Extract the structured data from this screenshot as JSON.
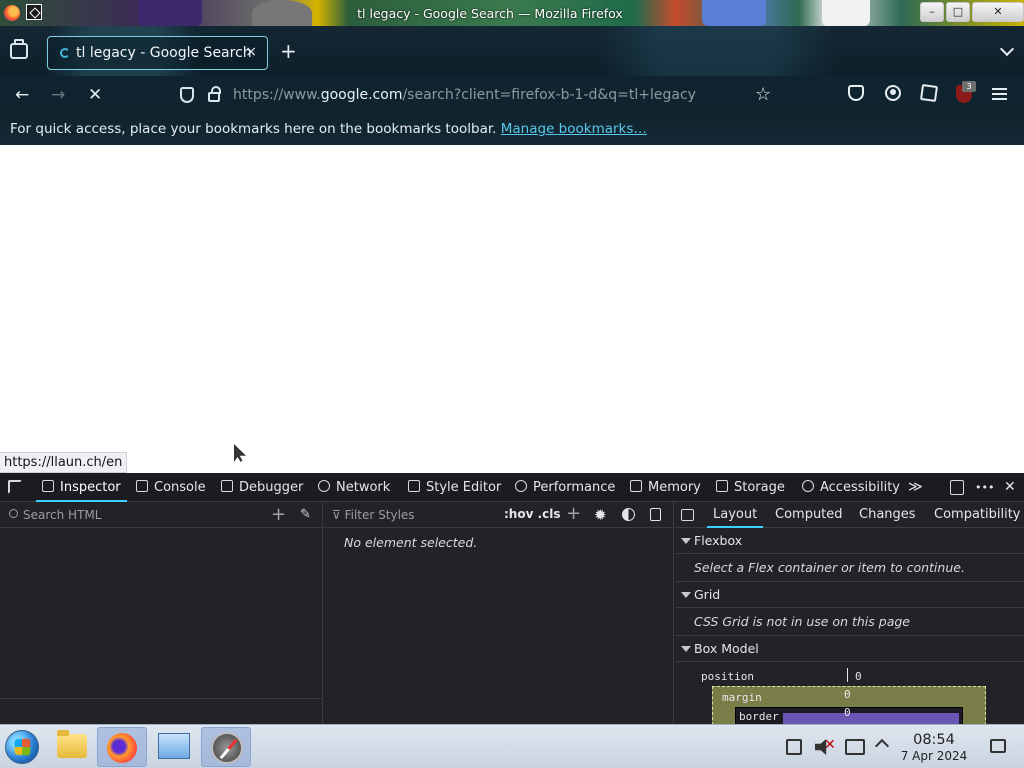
{
  "window": {
    "title": "tl legacy - Google Search — Mozilla Firefox",
    "minimize_glyph": "–",
    "maximize_glyph": "□",
    "close_glyph": "✕"
  },
  "tabs": [
    {
      "label": "tl legacy - Google Search",
      "close_glyph": "×"
    }
  ],
  "new_tab_glyph": "+",
  "navbar": {
    "back_glyph": "←",
    "forward_glyph": "→",
    "stop_glyph": "✕",
    "url_prefix": "https://www.",
    "url_host": "google.com",
    "url_path": "/search?client=firefox-b-1-d&q=tl+legacy",
    "star_glyph": "☆",
    "extension_badge": "3"
  },
  "bookmarks_toolbar": {
    "message": "For quick access, place your bookmarks here on the bookmarks toolbar.",
    "manage_link": "Manage bookmarks…"
  },
  "status_link": "https://llaun.ch/en",
  "devtools": {
    "tabs": [
      {
        "label": "Inspector",
        "icon": "inspector-icon",
        "active": true
      },
      {
        "label": "Console",
        "icon": "console-icon"
      },
      {
        "label": "Debugger",
        "icon": "debugger-icon"
      },
      {
        "label": "Network",
        "icon": "network-icon"
      },
      {
        "label": "Style Editor",
        "icon": "style-editor-icon"
      },
      {
        "label": "Performance",
        "icon": "performance-icon"
      },
      {
        "label": "Memory",
        "icon": "memory-icon"
      },
      {
        "label": "Storage",
        "icon": "storage-icon"
      },
      {
        "label": "Accessibility",
        "icon": "accessibility-icon"
      }
    ],
    "overflow_glyph": "≫",
    "more_glyph": "•••",
    "close_glyph": "✕",
    "search_html_placeholder": "Search HTML",
    "filter_styles_placeholder": "Filter Styles",
    "pseudo_toggle": ":hov",
    "class_toggle": ".cls",
    "add_glyph": "+",
    "no_element": "No element selected.",
    "layout_tabs": [
      "Layout",
      "Computed",
      "Changes",
      "Compatibility"
    ],
    "sections": {
      "flexbox": {
        "title": "Flexbox",
        "message": "Select a Flex container or item to continue."
      },
      "grid": {
        "title": "Grid",
        "message": "CSS Grid is not in use on this page"
      },
      "box_model": {
        "title": "Box Model",
        "position_label": "position",
        "position_value": "0",
        "margin_label": "margin",
        "margin_value": "0",
        "border_label": "border",
        "border_value": "0"
      }
    }
  },
  "taskbar": {
    "time": "08:54",
    "date": "7 Apr 2024"
  }
}
